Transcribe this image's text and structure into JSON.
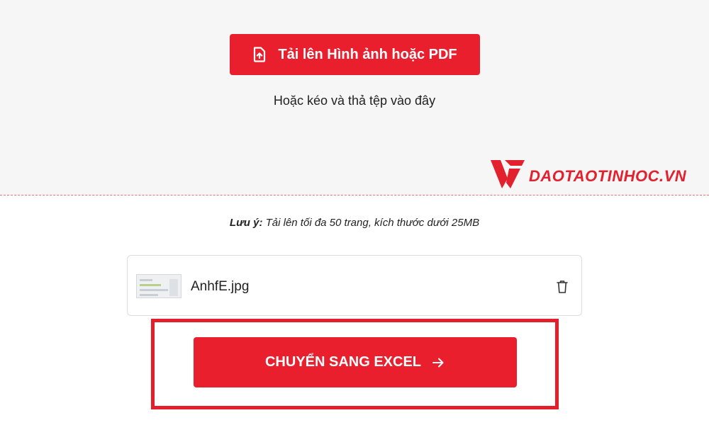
{
  "upload": {
    "button_label": "Tải lên Hình ảnh hoặc PDF",
    "drag_hint": "Hoặc kéo và thả tệp vào đây",
    "icon": "upload-file-icon"
  },
  "watermark": {
    "text": "DAOTAOTINHOC.VN",
    "color": "#e2202e"
  },
  "note": {
    "label": "Lưu ý:",
    "text": " Tải lên tối đa 50 trang, kích thước dưới 25MB"
  },
  "file": {
    "name": "AnhfE.jpg",
    "thumb_icon": "image-thumbnail",
    "delete_icon": "trash-icon"
  },
  "convert": {
    "label": "CHUYỂN SANG EXCEL",
    "icon": "arrow-right-icon"
  },
  "colors": {
    "accent": "#ea1f2e",
    "highlight_border": "#e41f2c",
    "zone_background": "#f6f6f6"
  }
}
